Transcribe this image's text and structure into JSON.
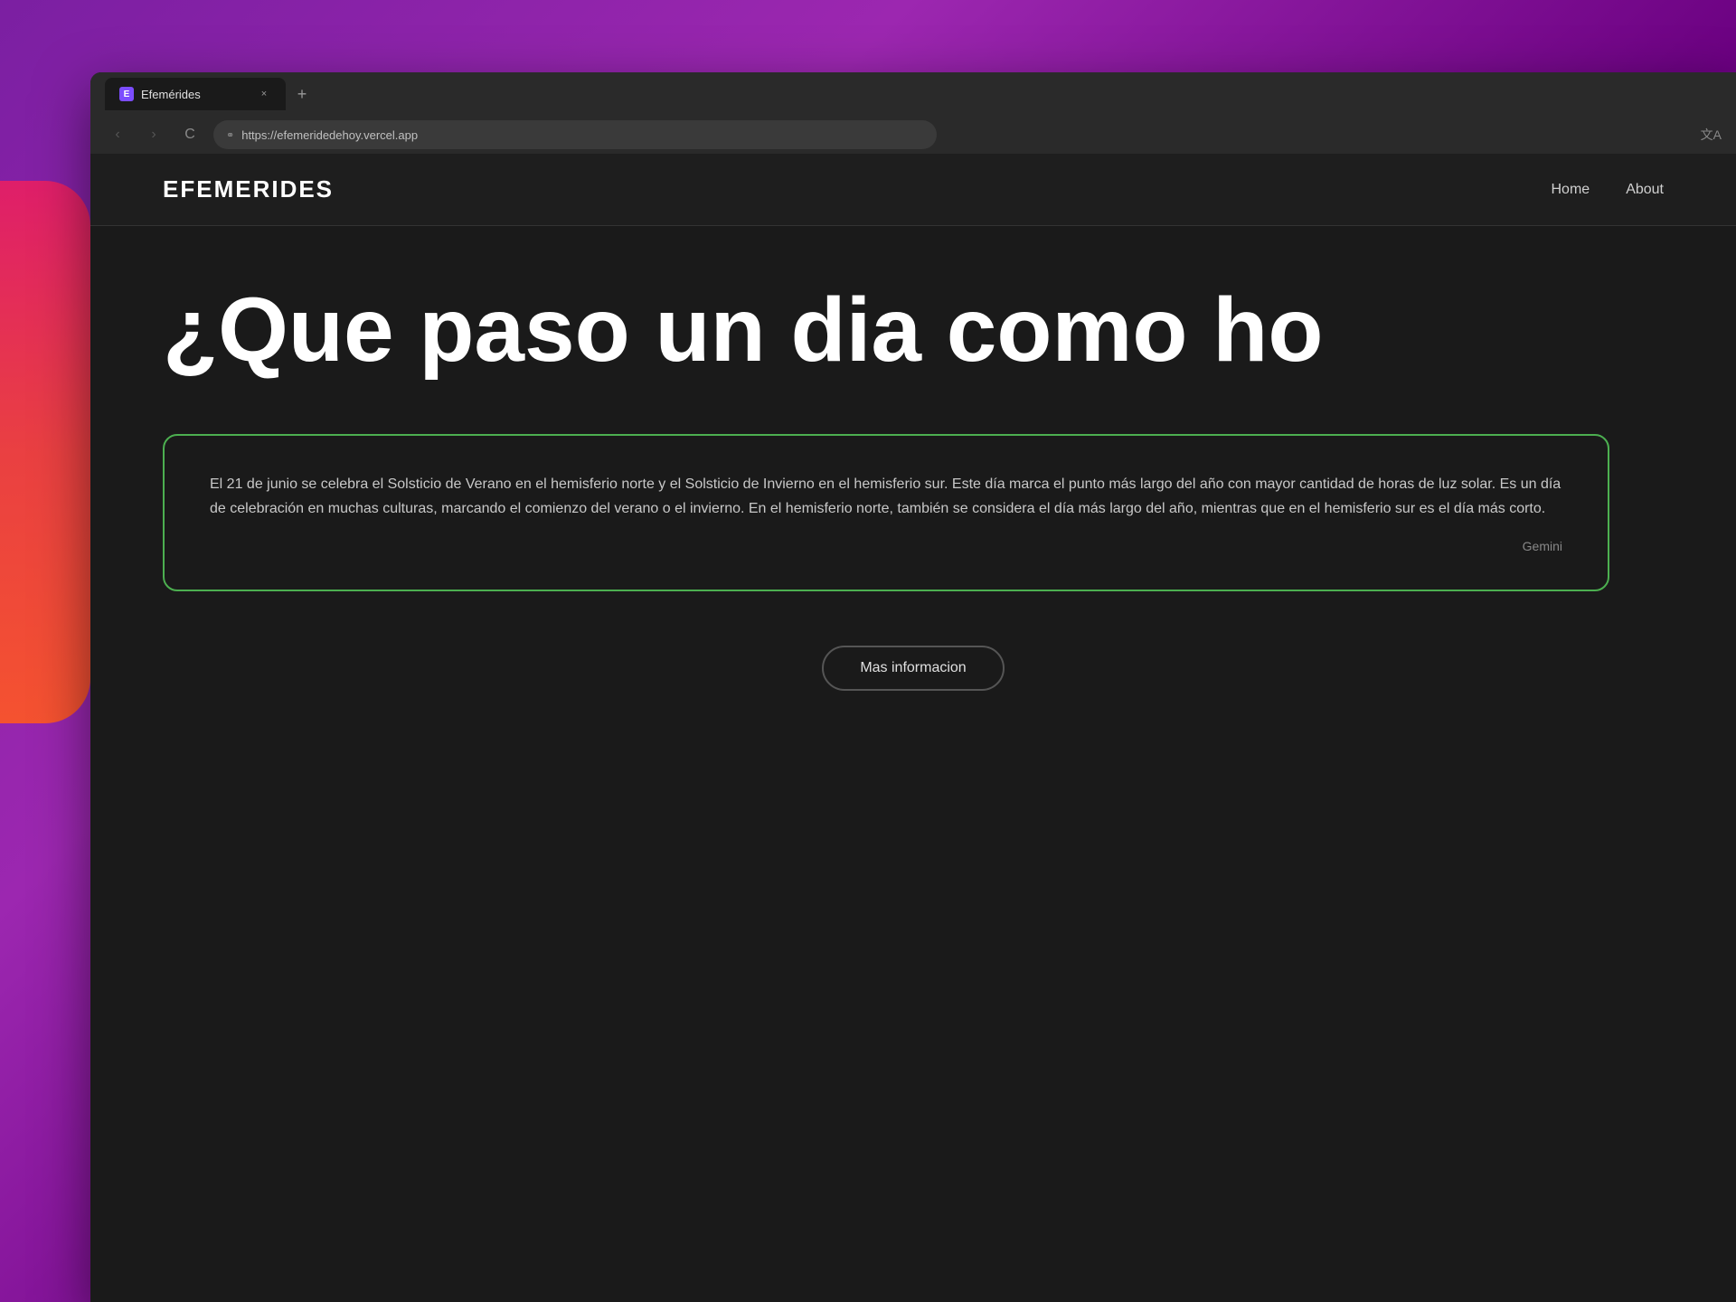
{
  "browser": {
    "tab": {
      "favicon_letter": "E",
      "title": "Efemérides",
      "close_icon": "×",
      "new_tab_icon": "+"
    },
    "nav": {
      "back_icon": "‹",
      "forward_icon": "›",
      "refresh_icon": "C",
      "url_lock_icon": "⚭",
      "url": "https://efemeridedehoy.vercel.app",
      "translate_icon": "文A"
    }
  },
  "website": {
    "logo": "EFEMERIDES",
    "nav": {
      "home_label": "Home",
      "about_label": "About"
    },
    "hero": {
      "title": "¿Que paso un dia como ho"
    },
    "card": {
      "body": "El 21 de junio se celebra el Solsticio de Verano en el hemisferio norte y el Solsticio de Invierno en el hemisferio sur. Este día marca el punto más largo del año con mayor cantidad de horas de luz solar. Es un día de celebración en muchas culturas, marcando el comienzo del verano o el invierno. En el hemisferio norte, también se considera el día más largo del año, mientras que en el hemisferio sur es el día más corto.",
      "attribution": "Gemini"
    },
    "button": {
      "label": "Mas informacion"
    }
  },
  "colors": {
    "card_border": "#4caf50",
    "brand_purple": "#7b1fa2",
    "accent_pink": "#e91e63"
  }
}
